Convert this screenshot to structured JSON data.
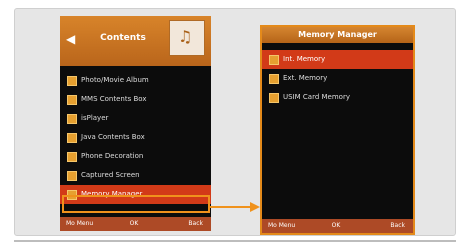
{
  "left_screen": {
    "header": {
      "back_icon": "chevron-left-icon",
      "title": "Contents",
      "folder_icon": "folder-music-icon"
    },
    "items": [
      {
        "label": "Photo/Movie Album",
        "icon": "folder-icon"
      },
      {
        "label": "MMS Contents Box",
        "icon": "folder-icon"
      },
      {
        "label": "isPlayer",
        "icon": "folder-icon"
      },
      {
        "label": "Java Contents Box",
        "icon": "folder-icon"
      },
      {
        "label": "Phone Decoration",
        "icon": "folder-icon"
      },
      {
        "label": "Captured Screen",
        "icon": "folder-icon"
      },
      {
        "label": "Memory Manager",
        "icon": "folder-icon",
        "selected": true
      }
    ],
    "softkeys": {
      "left": "Mo Menu",
      "center": "OK",
      "right": "Back"
    }
  },
  "right_screen": {
    "header": {
      "title": "Memory Manager"
    },
    "items": [
      {
        "label": "Int. Memory",
        "icon": "folder-icon",
        "selected": true
      },
      {
        "label": "Ext. Memory",
        "icon": "folder-icon"
      },
      {
        "label": "USIM Card Memory",
        "icon": "folder-icon"
      }
    ],
    "softkeys": {
      "left": "Mo Menu",
      "center": "OK",
      "right": "Back"
    }
  },
  "colors": {
    "accent": "#e48a1a",
    "selected_row": "#d23a18",
    "header": "#c77424",
    "screen_bg": "#0c0c0c"
  }
}
